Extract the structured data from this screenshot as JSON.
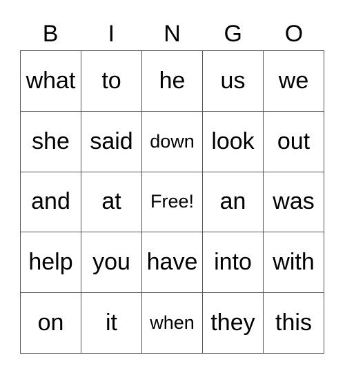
{
  "header": [
    "B",
    "I",
    "N",
    "G",
    "O"
  ],
  "rows": [
    [
      {
        "t": "what"
      },
      {
        "t": "to"
      },
      {
        "t": "he"
      },
      {
        "t": "us"
      },
      {
        "t": "we"
      }
    ],
    [
      {
        "t": "she"
      },
      {
        "t": "said"
      },
      {
        "t": "down",
        "small": true
      },
      {
        "t": "look"
      },
      {
        "t": "out"
      }
    ],
    [
      {
        "t": "and"
      },
      {
        "t": "at"
      },
      {
        "t": "Free!",
        "small": true
      },
      {
        "t": "an"
      },
      {
        "t": "was"
      }
    ],
    [
      {
        "t": "help"
      },
      {
        "t": "you"
      },
      {
        "t": "have"
      },
      {
        "t": "into"
      },
      {
        "t": "with"
      }
    ],
    [
      {
        "t": "on"
      },
      {
        "t": "it"
      },
      {
        "t": "when",
        "small": true
      },
      {
        "t": "they"
      },
      {
        "t": "this"
      }
    ]
  ]
}
